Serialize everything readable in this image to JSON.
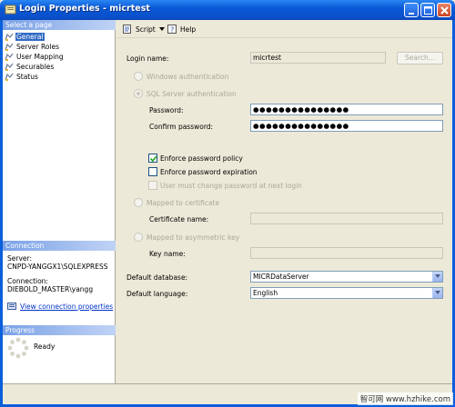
{
  "window": {
    "title": "Login Properties - micrtest"
  },
  "left": {
    "select_page_header": "Select a page",
    "pages": [
      {
        "label": "General",
        "icon": "page-icon",
        "selected": true
      },
      {
        "label": "Server Roles",
        "icon": "page-icon"
      },
      {
        "label": "User Mapping",
        "icon": "page-icon"
      },
      {
        "label": "Securables",
        "icon": "page-icon"
      },
      {
        "label": "Status",
        "icon": "page-icon"
      }
    ],
    "connection_header": "Connection",
    "server_label": "Server:",
    "server_value": "CNPD-YANGGX1\\SQLEXPRESS",
    "connection_label": "Connection:",
    "connection_value": "DIEBOLD_MASTER\\yangg",
    "view_connection_link": "View connection properties",
    "progress_header": "Progress",
    "progress_status": "Ready"
  },
  "toolbar": {
    "script_label": "Script",
    "help_label": "Help"
  },
  "form": {
    "login_name_label": "Login name:",
    "login_name_value": "micrtest",
    "search_button": "Search...",
    "windows_auth_label": "Windows authentication",
    "sql_auth_label": "SQL Server authentication",
    "password_label": "Password:",
    "password_value": "●●●●●●●●●●●●●●●",
    "confirm_password_label": "Confirm password:",
    "confirm_password_value": "●●●●●●●●●●●●●●●",
    "enforce_policy_label": "Enforce password policy",
    "enforce_expiration_label": "Enforce password expiration",
    "must_change_label": "User must change password at next login",
    "mapped_cert_label": "Mapped to certificate",
    "cert_name_label": "Certificate name:",
    "mapped_asym_label": "Mapped to asymmetric key",
    "key_name_label": "Key name:",
    "default_db_label": "Default database:",
    "default_db_value": "MICRDataServer",
    "default_lang_label": "Default language:",
    "default_lang_value": "English"
  },
  "watermark": {
    "text": "智可网 www.hzhike.com"
  },
  "colors": {
    "title_bar": "#0a58d6",
    "selection": "#316ac5",
    "section_header": "#7aa1e6",
    "link": "#0033cc"
  }
}
